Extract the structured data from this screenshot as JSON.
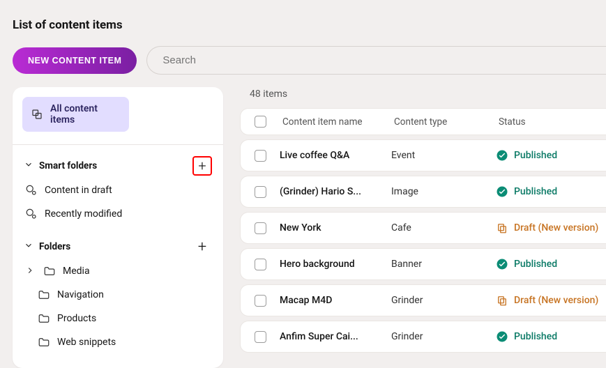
{
  "page_title": "List of content items",
  "new_button": "NEW CONTENT ITEM",
  "search": {
    "placeholder": "Search"
  },
  "sidebar": {
    "all_items_label": "All content items",
    "smart_folders": {
      "label": "Smart folders",
      "items": [
        {
          "label": "Content in draft"
        },
        {
          "label": "Recently modified"
        }
      ]
    },
    "folders": {
      "label": "Folders",
      "items": [
        {
          "label": "Media",
          "expandable": true
        },
        {
          "label": "Navigation"
        },
        {
          "label": "Products"
        },
        {
          "label": "Web snippets"
        }
      ]
    }
  },
  "list": {
    "count_text": "48 items",
    "columns": {
      "name": "Content item name",
      "type": "Content type",
      "status": "Status"
    },
    "rows": [
      {
        "name": "Live coffee Q&A",
        "type": "Event",
        "status": "Published",
        "status_kind": "published"
      },
      {
        "name": "(Grinder) Hario S...",
        "type": "Image",
        "status": "Published",
        "status_kind": "published"
      },
      {
        "name": "New York",
        "type": "Cafe",
        "status": "Draft (New version)",
        "status_kind": "draft"
      },
      {
        "name": "Hero background",
        "type": "Banner",
        "status": "Published",
        "status_kind": "published"
      },
      {
        "name": "Macap M4D",
        "type": "Grinder",
        "status": "Draft (New version)",
        "status_kind": "draft"
      },
      {
        "name": "Anfim Super Cai...",
        "type": "Grinder",
        "status": "Published",
        "status_kind": "published"
      }
    ]
  }
}
